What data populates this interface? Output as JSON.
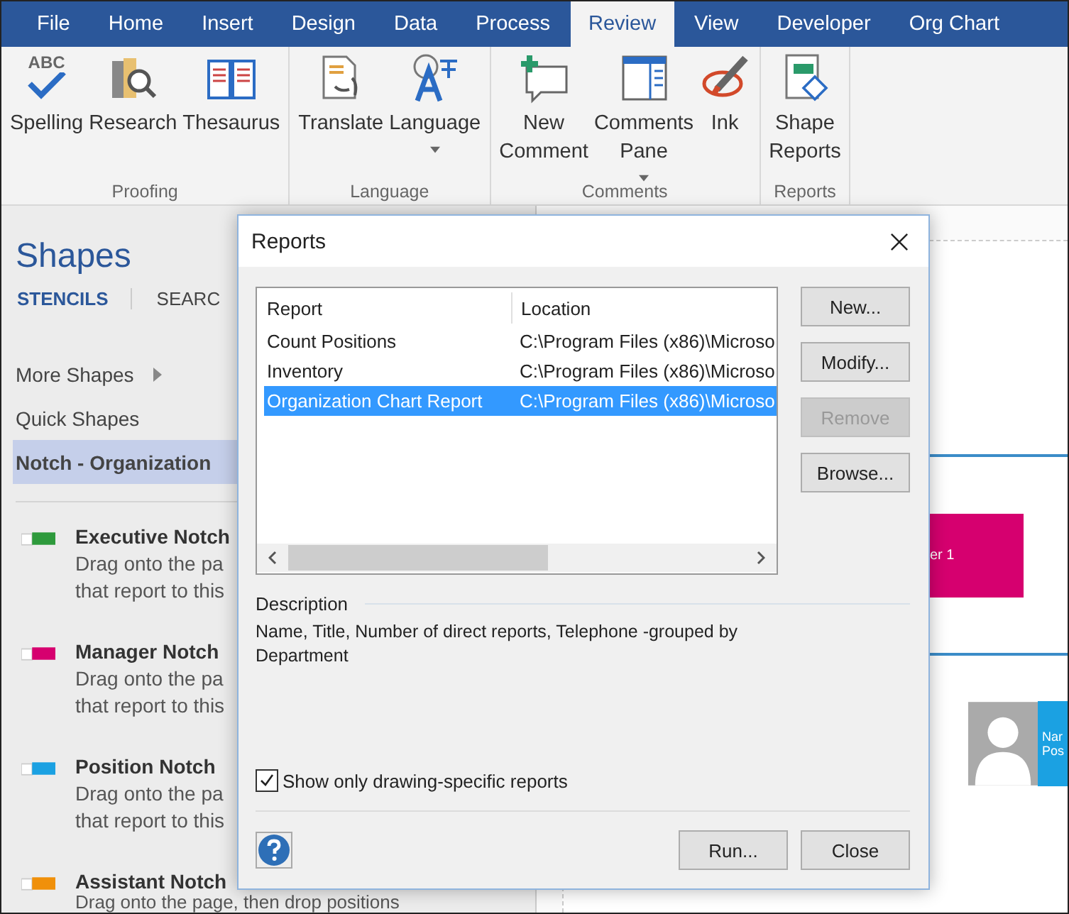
{
  "tabs": [
    {
      "label": "File",
      "selected": false
    },
    {
      "label": "Home",
      "selected": false
    },
    {
      "label": "Insert",
      "selected": false
    },
    {
      "label": "Design",
      "selected": false
    },
    {
      "label": "Data",
      "selected": false
    },
    {
      "label": "Process",
      "selected": false
    },
    {
      "label": "Review",
      "selected": true
    },
    {
      "label": "View",
      "selected": false
    },
    {
      "label": "Developer",
      "selected": false
    },
    {
      "label": "Org Chart",
      "selected": false
    }
  ],
  "ribbon": {
    "groups": [
      {
        "label": "Proofing",
        "buttons": [
          {
            "kind": "spelling",
            "icon_text": "ABC",
            "lines": [
              "Spelling"
            ],
            "dropdown": false
          },
          {
            "kind": "research",
            "lines": [
              "Research"
            ],
            "dropdown": false
          },
          {
            "kind": "thesaurus",
            "lines": [
              "Thesaurus"
            ],
            "dropdown": false
          }
        ]
      },
      {
        "label": "Language",
        "buttons": [
          {
            "kind": "translate",
            "lines": [
              "Translate"
            ],
            "dropdown": false
          },
          {
            "kind": "language",
            "lines": [
              "Language"
            ],
            "dropdown": true
          }
        ]
      },
      {
        "label": "Comments",
        "buttons": [
          {
            "kind": "new-comment",
            "lines": [
              "New",
              "Comment"
            ],
            "dropdown": false
          },
          {
            "kind": "comments-pane",
            "lines": [
              "Comments",
              "Pane"
            ],
            "dropdown": true
          },
          {
            "kind": "ink",
            "lines": [
              "Ink"
            ],
            "dropdown": false
          }
        ]
      },
      {
        "label": "Reports",
        "buttons": [
          {
            "kind": "shape-reports",
            "lines": [
              "Shape",
              "Reports"
            ],
            "dropdown": false
          }
        ]
      }
    ]
  },
  "shapes_panel": {
    "title": "Shapes",
    "tabs": [
      {
        "label": "STENCILS",
        "selected": true
      },
      {
        "label": "SEARC",
        "selected": false
      }
    ],
    "items": [
      {
        "label": "More Shapes",
        "kind": "submenu",
        "selected": false
      },
      {
        "label": "Quick Shapes",
        "kind": "plain",
        "selected": false
      },
      {
        "label": "Notch - Organization",
        "kind": "plain",
        "selected": true
      }
    ],
    "stencil": [
      {
        "name": "Executive Notch",
        "color": "#2e9a3c",
        "lines": [
          "Drag onto the pa",
          "that report to this"
        ]
      },
      {
        "name": "Manager Notch",
        "color": "#d6006f",
        "lines": [
          "Drag onto the pa",
          "that report to this"
        ]
      },
      {
        "name": "Position Notch",
        "color": "#1ba1e2",
        "lines": [
          "Drag onto the pa",
          "that report to this"
        ]
      },
      {
        "name": "Assistant Notch",
        "color": "#f0900a",
        "lines": [
          "Drag onto the page, then drop positions"
        ]
      }
    ]
  },
  "canvas": {
    "manager_box": "er 1",
    "position_box": [
      "Nar",
      "Pos"
    ]
  },
  "dialog": {
    "title": "Reports",
    "columns": [
      "Report",
      "Location"
    ],
    "rows": [
      {
        "report": "Count Positions",
        "location": "C:\\Program Files (x86)\\Microso",
        "selected": false
      },
      {
        "report": "Inventory",
        "location": "C:\\Program Files (x86)\\Microso",
        "selected": false
      },
      {
        "report": "Organization Chart Report",
        "location": "C:\\Program Files (x86)\\Microso",
        "selected": true
      }
    ],
    "side_buttons": [
      {
        "label": "New...",
        "disabled": false
      },
      {
        "label": "Modify...",
        "disabled": false
      },
      {
        "label": "Remove",
        "disabled": true
      },
      {
        "label": "Browse...",
        "disabled": false
      }
    ],
    "description_label": "Description",
    "description": "Name, Title, Number of direct reports, Telephone -grouped by Department",
    "checkbox": {
      "label": "Show only drawing-specific reports",
      "checked": true
    },
    "buttons": [
      "Run...",
      "Close"
    ]
  }
}
